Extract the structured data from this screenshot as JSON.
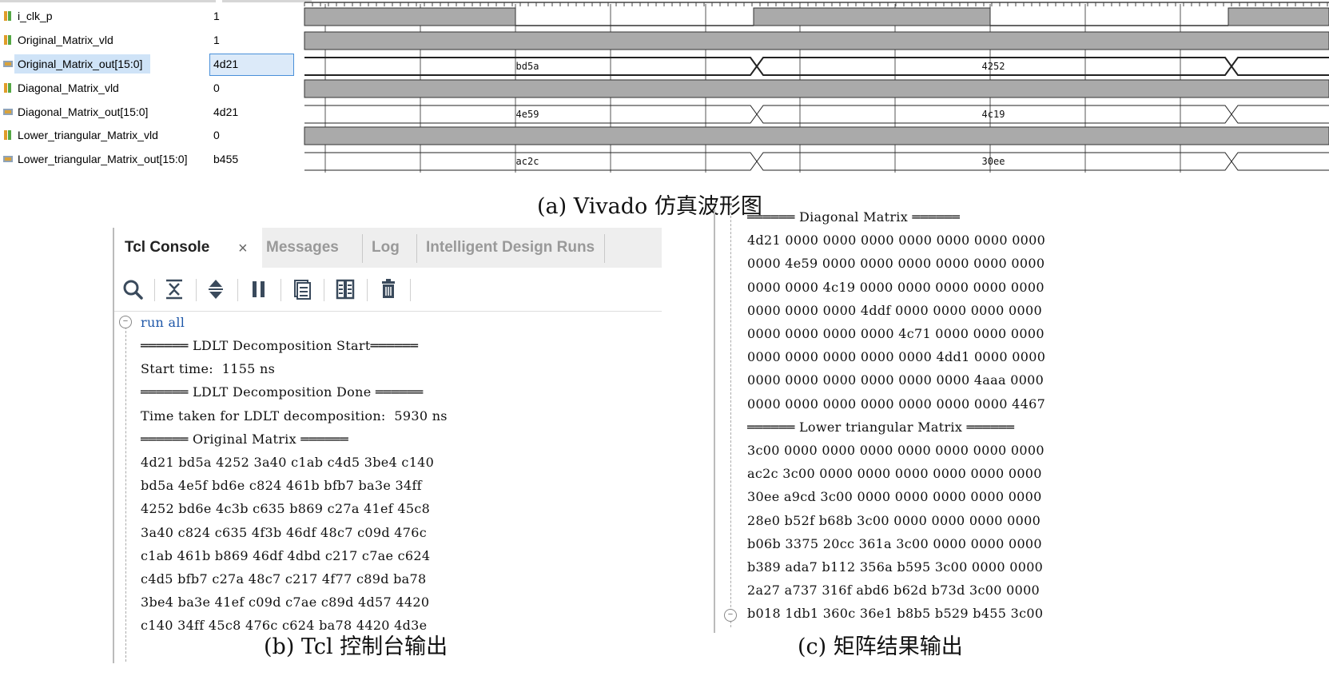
{
  "waveform": {
    "signals": [
      {
        "name": "i_clk_p",
        "value": "1",
        "kind": "bit",
        "icon": "bit-signal-icon"
      },
      {
        "name": "Original_Matrix_vld",
        "value": "1",
        "kind": "bit",
        "icon": "bit-signal-icon"
      },
      {
        "name": "Original_Matrix_out[15:0]",
        "value": "4d21",
        "kind": "bus",
        "icon": "bus-signal-icon",
        "selected": true,
        "segments": [
          "bd5a",
          "4252"
        ]
      },
      {
        "name": "Diagonal_Matrix_vld",
        "value": "0",
        "kind": "bit",
        "icon": "bit-signal-icon"
      },
      {
        "name": "Diagonal_Matrix_out[15:0]",
        "value": "4d21",
        "kind": "bus",
        "icon": "bus-signal-icon",
        "segments": [
          "4e59",
          "4c19"
        ]
      },
      {
        "name": "Lower_triangular_Matrix_vld",
        "value": "0",
        "kind": "bit",
        "icon": "bit-signal-icon"
      },
      {
        "name": "Lower_triangular_Matrix_out[15:0]",
        "value": "b455",
        "kind": "bus",
        "icon": "bus-signal-icon",
        "segments": [
          "ac2c",
          "30ee"
        ]
      }
    ]
  },
  "captions": {
    "a": "(a) Vivado 仿真波形图",
    "b": "(b) Tcl 控制台输出",
    "c": "(c) 矩阵结果输出"
  },
  "tcl": {
    "tabs": [
      {
        "label": "Tcl Console",
        "active": true
      },
      {
        "label": "Messages",
        "active": false
      },
      {
        "label": "Log",
        "active": false
      },
      {
        "label": "Intelligent Design Runs",
        "active": false
      }
    ],
    "close_glyph": "×",
    "toolbar": [
      "search-icon",
      "collapse-all-icon",
      "expand-all-icon",
      "pause-icon",
      "copy-icon",
      "columns-icon",
      "delete-icon"
    ],
    "command": "run all",
    "lines": [
      "══════ LDLT Decomposition Start══════",
      "Start time:  1155 ns",
      "══════ LDLT Decomposition Done ══════",
      "Time taken for LDLT decomposition:  5930 ns",
      "══════ Original Matrix ══════",
      "4d21 bd5a 4252 3a40 c1ab c4d5 3be4 c140",
      "bd5a 4e5f bd6e c824 461b bfb7 ba3e 34ff",
      "4252 bd6e 4c3b c635 b869 c27a 41ef 45c8",
      "3a40 c824 c635 4f3b 46df 48c7 c09d 476c",
      "c1ab 461b b869 46df 4dbd c217 c7ae c624",
      "c4d5 bfb7 c27a 48c7 c217 4f77 c89d ba78",
      "3be4 ba3e 41ef c09d c7ae c89d 4d57 4420",
      "c140 34ff 45c8 476c c624 ba78 4420 4d3e"
    ]
  },
  "matrix": {
    "lines": [
      "══════ Diagonal Matrix ══════",
      "4d21 0000 0000 0000 0000 0000 0000 0000",
      "0000 4e59 0000 0000 0000 0000 0000 0000",
      "0000 0000 4c19 0000 0000 0000 0000 0000",
      "0000 0000 0000 4ddf 0000 0000 0000 0000",
      "0000 0000 0000 0000 4c71 0000 0000 0000",
      "0000 0000 0000 0000 0000 4dd1 0000 0000",
      "0000 0000 0000 0000 0000 0000 4aaa 0000",
      "0000 0000 0000 0000 0000 0000 0000 4467",
      "══════ Lower triangular Matrix ══════",
      "3c00 0000 0000 0000 0000 0000 0000 0000",
      "ac2c 3c00 0000 0000 0000 0000 0000 0000",
      "30ee a9cd 3c00 0000 0000 0000 0000 0000",
      "28e0 b52f b68b 3c00 0000 0000 0000 0000",
      "b06b 3375 20cc 361a 3c00 0000 0000 0000",
      "b389 ada7 b112 356a b595 3c00 0000 0000",
      "2a27 a737 316f abd6 b62d b73d 3c00 0000",
      "b018 1db1 360c 36e1 b8b5 b529 b455 3c00"
    ]
  },
  "colors": {
    "wave_fill": "#aaaaaa",
    "selection": "#cfe3f7",
    "tcl_command": "#1e57a8",
    "tab_inactive": "#999999"
  }
}
